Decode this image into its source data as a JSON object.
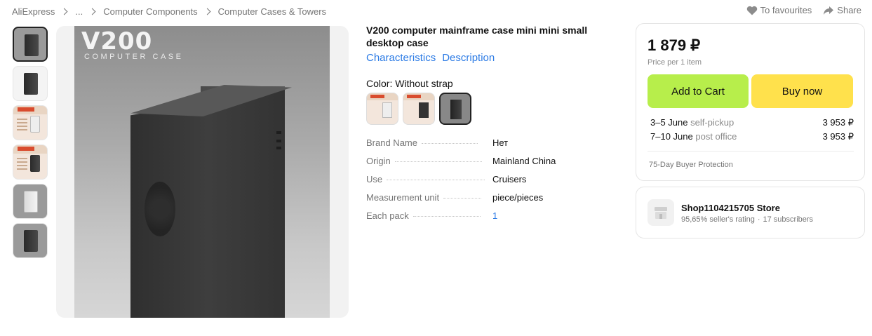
{
  "breadcrumb": [
    "AliExpress",
    "...",
    "Computer Components",
    "Computer Cases & Towers"
  ],
  "top_actions": {
    "favourites": "To favourites",
    "share": "Share"
  },
  "gallery": {
    "brand_logo": "V200",
    "brand_sub": "COMPUTER CASE"
  },
  "product": {
    "title": "V200 computer mainframe case mini mini small desktop case",
    "tabs": [
      "Characteristics",
      "Description"
    ],
    "color_label": "Color: Without strap",
    "specs": [
      {
        "name": "Brand Name",
        "value": "Нет"
      },
      {
        "name": "Origin",
        "value": "Mainland China"
      },
      {
        "name": "Use",
        "value": "Cruisers"
      },
      {
        "name": "Measurement unit",
        "value": "piece/pieces"
      },
      {
        "name": "Each pack",
        "value": "1"
      }
    ]
  },
  "buy": {
    "price": "1 879 ₽",
    "price_note": "Price per 1 item",
    "add_to_cart": "Add to Cart",
    "buy_now": "Buy now",
    "delivery": [
      {
        "date": "3–5 June",
        "method": "self-pickup",
        "price": "3 953 ₽"
      },
      {
        "date": "7–10 June",
        "method": "post office",
        "price": "3 953 ₽"
      }
    ],
    "protection": "75-Day Buyer Protection",
    "accent_colors": {
      "cart": "#b7ee4b",
      "buy": "#ffe14c",
      "link": "#2c7be5"
    }
  },
  "store": {
    "name": "Shop1104215705 Store",
    "rating": "95,65% seller's rating",
    "separator": "·",
    "subscribers": "17 subscribers"
  }
}
